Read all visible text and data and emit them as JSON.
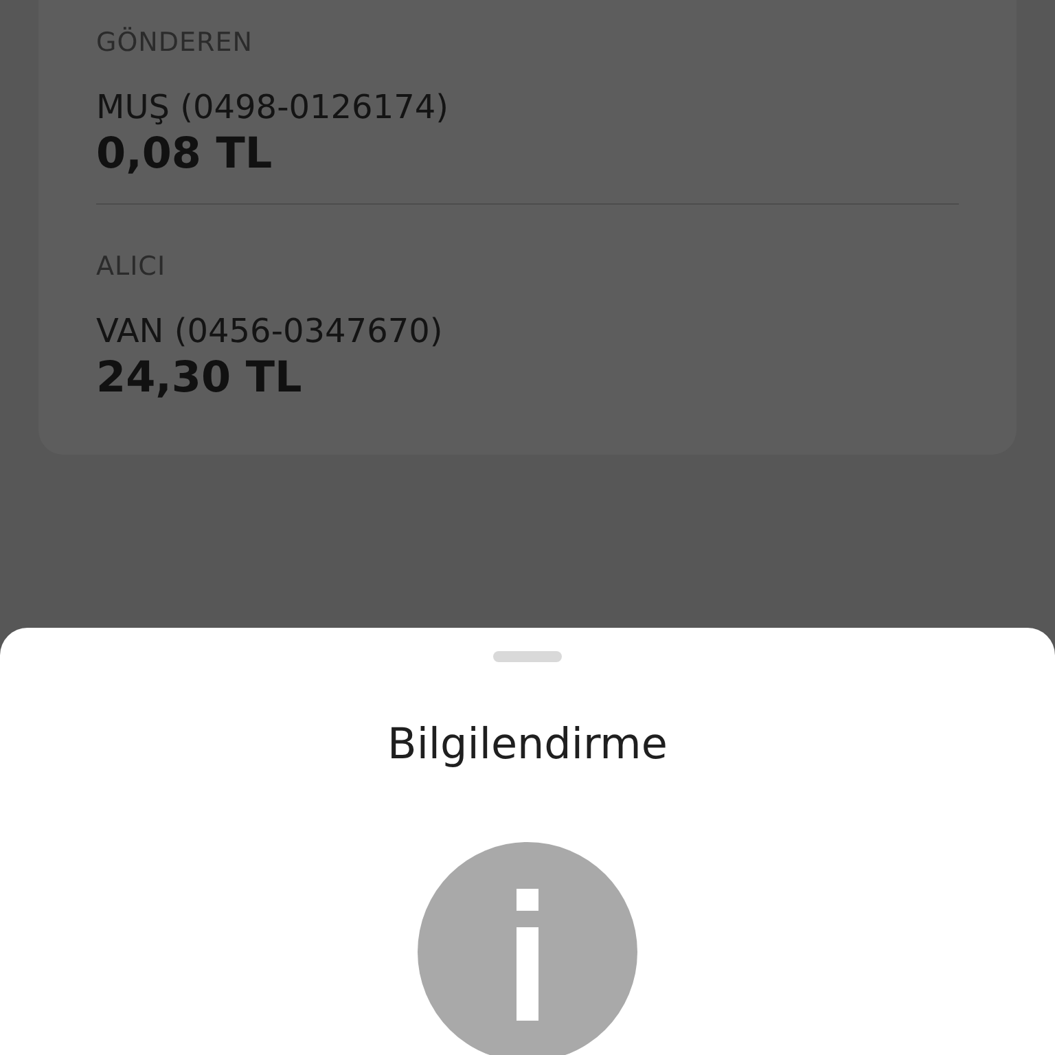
{
  "card": {
    "sections": [
      {
        "label": "GÖNDEREN",
        "account": "MUŞ (0498-0126174)",
        "amount": "0,08 TL"
      },
      {
        "label": "ALICI",
        "account": "VAN (0456-0347670)",
        "amount": "24,30 TL"
      }
    ]
  },
  "sheet": {
    "title": "Bilgilendirme"
  }
}
